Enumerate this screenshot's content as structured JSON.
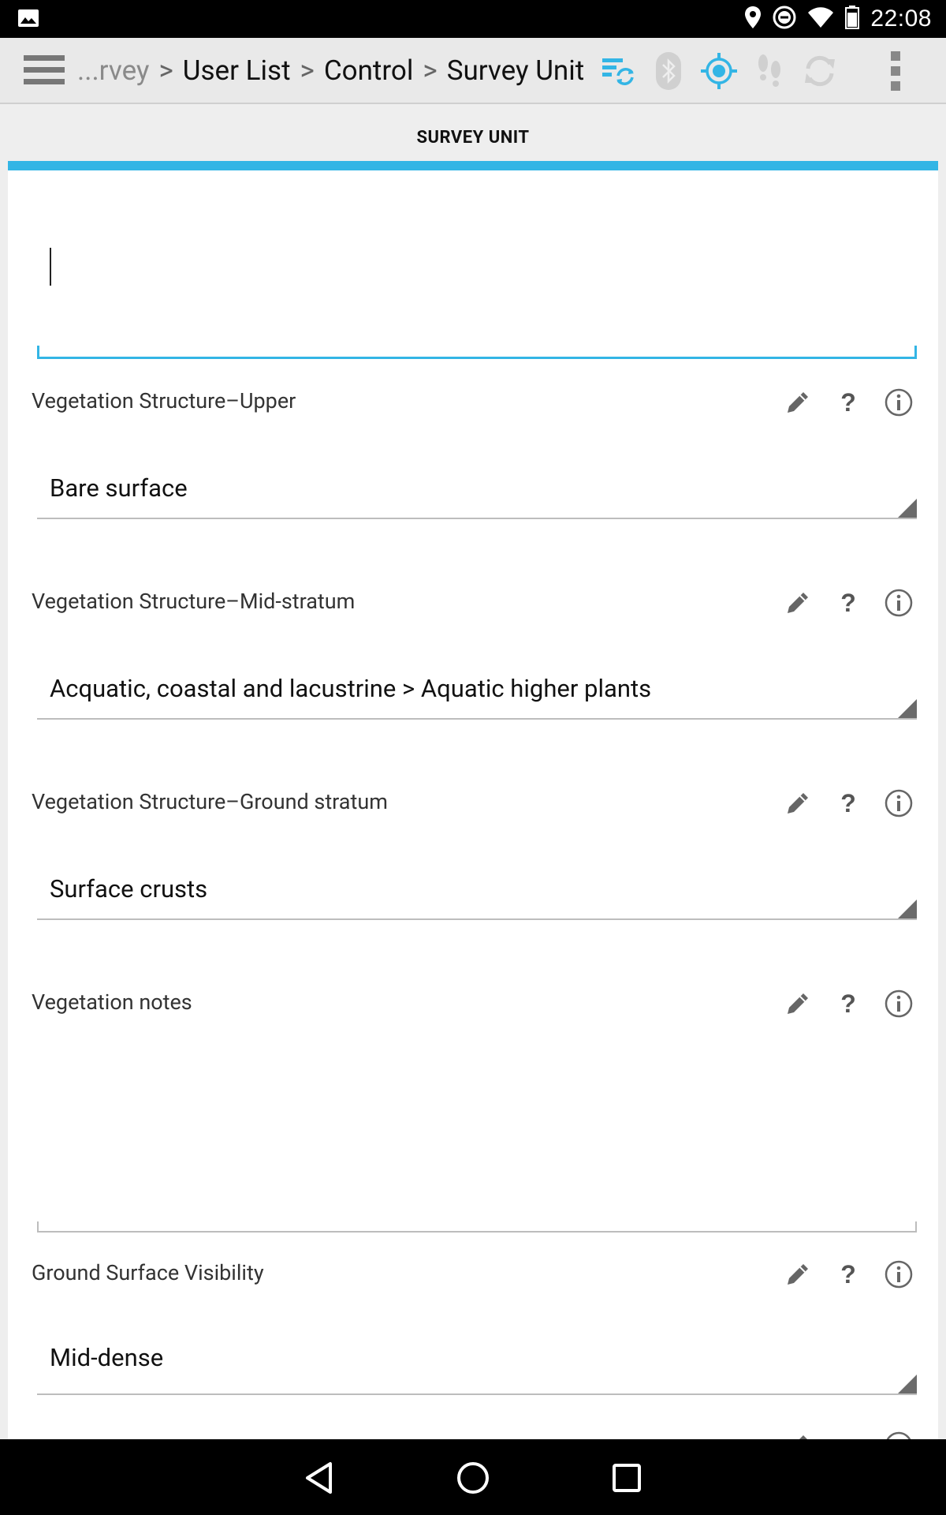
{
  "status_bar": {
    "time": "22:08"
  },
  "action_bar": {
    "breadcrumb": {
      "truncated": "...rvey",
      "separator": ">",
      "items": [
        "User List",
        "Control",
        "Survey Unit"
      ]
    },
    "icons": [
      "menu-icon",
      "sync-list-icon",
      "bluetooth-icon",
      "gps-icon",
      "footprints-icon",
      "refresh-icon",
      "overflow-menu-icon"
    ]
  },
  "tab": {
    "label": "SURVEY UNIT"
  },
  "name_field": {
    "value": ""
  },
  "fields": [
    {
      "label": "Vegetation Structure–Upper",
      "value": "Bare surface",
      "type": "select"
    },
    {
      "label": "Vegetation Structure–Mid-stratum",
      "value": "Acquatic, coastal and lacustrine > Aquatic higher plants",
      "type": "select"
    },
    {
      "label": "Vegetation Structure–Ground stratum",
      "value": "Surface crusts",
      "type": "select"
    },
    {
      "label": "Vegetation notes",
      "value": "",
      "type": "textarea"
    },
    {
      "label": "Ground Surface Visibility",
      "value": "Mid-dense",
      "type": "select"
    }
  ],
  "field_actions": {
    "help_glyph": "?"
  },
  "colors": {
    "accent": "#33b5e5",
    "statusbar": "#000000",
    "actionbar": "#e9e9e9"
  }
}
